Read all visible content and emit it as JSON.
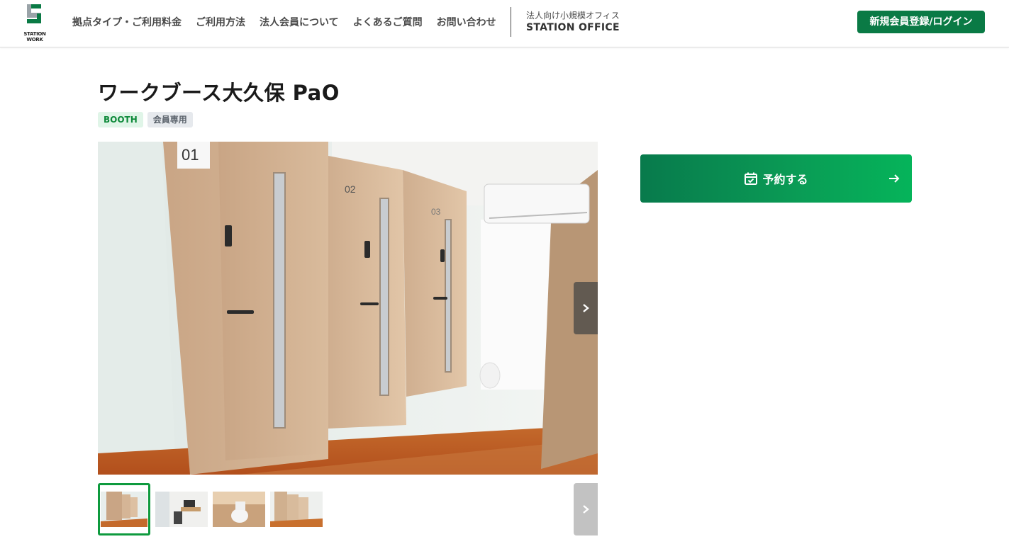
{
  "header": {
    "logo_text": "STATION\nWORK",
    "nav": [
      {
        "label": "拠点タイプ・ご利用料金"
      },
      {
        "label": "ご利用方法"
      },
      {
        "label": "法人会員について"
      },
      {
        "label": "よくあるご質問"
      },
      {
        "label": "お問い合わせ"
      }
    ],
    "office_sub": "法人向け小規模オフィス",
    "office_main": "STATION OFFICE",
    "login_label": "新規会員登録/ログイン"
  },
  "page": {
    "title": "ワークブース大久保 PaO",
    "tags": [
      {
        "label": "BOOTH"
      },
      {
        "label": "会員専用"
      }
    ]
  },
  "gallery": {
    "booth_labels": [
      "01",
      "02",
      "03"
    ],
    "thumbnail_count": 4,
    "active_thumbnail": 1
  },
  "reserve": {
    "label": "予約する"
  },
  "colors": {
    "brand_green": "#0a7a45",
    "active_border": "#0e9a3e",
    "booth_tag_bg": "#e0f5e8",
    "booth_tag_text": "#0e8a3a"
  },
  "icons": {
    "reserve": "calendar-check-icon",
    "reserve_arrow": "arrow-right-icon",
    "gallery_next": "chevron-right-icon"
  }
}
